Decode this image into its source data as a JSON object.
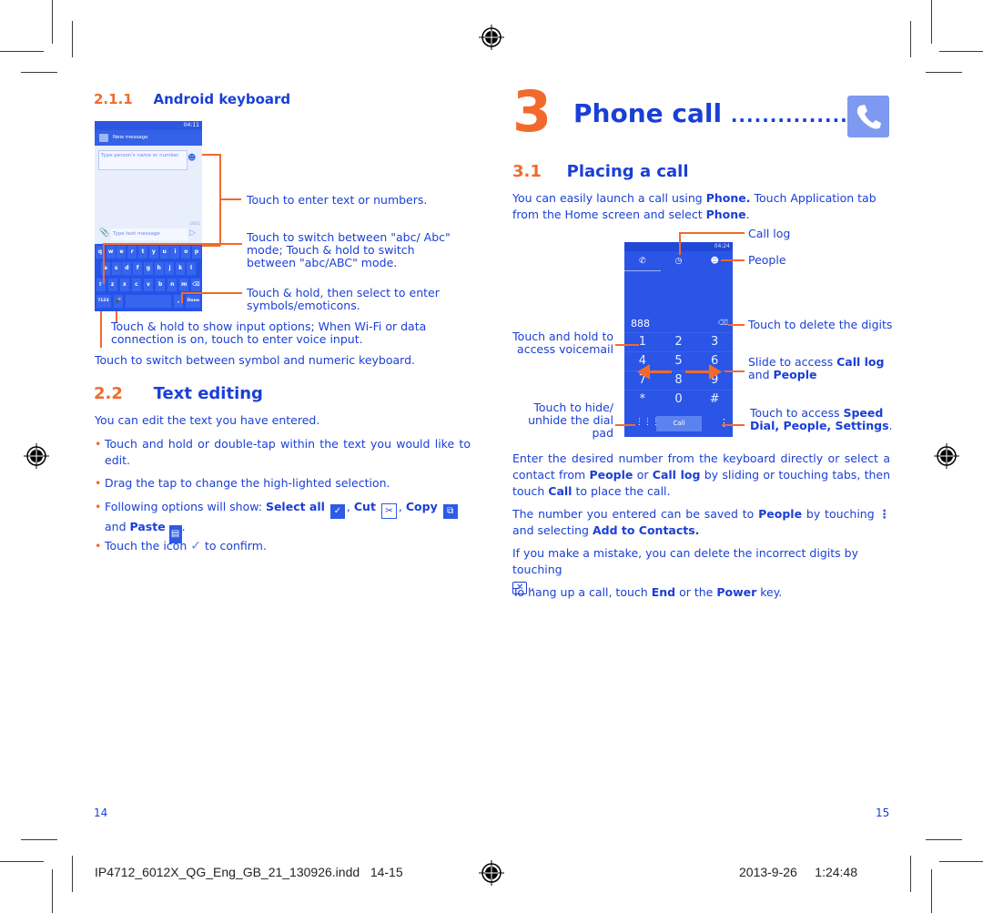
{
  "left_page": {
    "section_211": {
      "number": "2.1.1",
      "title": "Android keyboard"
    },
    "keyboard_phone": {
      "status_time": "04:11",
      "title": "New message",
      "recipient_placeholder": "Type person's name or number",
      "message_placeholder": "Type text message",
      "char_count": "160/1",
      "keys_row1": [
        "q",
        "w",
        "e",
        "r",
        "t",
        "y",
        "u",
        "i",
        "o",
        "p"
      ],
      "keys_row2": [
        "a",
        "s",
        "d",
        "f",
        "g",
        "h",
        "j",
        "k",
        "l"
      ],
      "keys_row3": [
        "z",
        "x",
        "c",
        "v",
        "b",
        "n",
        "m"
      ],
      "sym_key": "?123",
      "done_key": "Done"
    },
    "callouts": {
      "enter_text": "Touch to enter text or numbers.",
      "switch_case": "Touch to switch  between \"abc/ Abc\" mode; Touch & hold to switch between \"abc/ABC\" mode.",
      "symbols": "Touch & hold, then select to enter symbols/emoticons.",
      "voice": "Touch & hold to show input options; When Wi-Fi or data connection is on, touch to enter voice input.",
      "numeric": "Touch to switch between symbol and numeric keyboard."
    },
    "section_22": {
      "number": "2.2",
      "title": "Text editing"
    },
    "intro": "You can edit the text you have entered.",
    "bullets": {
      "b1": "Touch and hold or double-tap within the text you would like to edit.",
      "b2": "Drag the tap to change the high-lighted selection.",
      "b3_prefix": "Following options will show: ",
      "b3_select_all": "Select all",
      "b3_cut": "Cut",
      "b3_copy": "Copy",
      "b3_and": "and",
      "b3_paste": "Paste",
      "b4_prefix": "Touch the icon",
      "b4_suffix": "to confirm."
    },
    "page_number": "14"
  },
  "right_page": {
    "chapter": {
      "number": "3",
      "title": "Phone call",
      "leader": "..............."
    },
    "section_31": {
      "number": "3.1",
      "title": "Placing a call"
    },
    "intro_p1": "You can easily launch a call using",
    "intro_phone": "Phone.",
    "intro_p2": "Touch Application tab from the Home screen and select",
    "intro_phone2": "Phone",
    "dialer_phone": {
      "status_time": "04:24",
      "number": "888",
      "keys": [
        [
          "1",
          "2",
          "3"
        ],
        [
          "4",
          "5",
          "6"
        ],
        [
          "7",
          "8",
          "9"
        ],
        [
          "*",
          "0",
          "#"
        ]
      ],
      "call_button": "Call"
    },
    "callouts": {
      "call_log": "Call log",
      "people": "People",
      "delete": "Touch to delete the digits",
      "voicemail": "Touch and hold to access voicemail",
      "slide_pre": "Slide to access",
      "slide_call": "Call log",
      "slide_and": "and",
      "slide_people": "People",
      "hide_pad": "Touch to hide/ unhide the dial pad",
      "speed_pre": "Touch to access",
      "speed_bold": "Speed Dial, People, Settings"
    },
    "para1": {
      "a": "Enter the desired number from the keyboard directly or select a contact from",
      "b": "People",
      "c": "or",
      "d": "Call log",
      "e": "by sliding or touching tabs, then touch",
      "f": "Call",
      "g": "to place the call."
    },
    "para2": {
      "a": "The number you entered can be saved to",
      "b": "People",
      "c": "by touching",
      "d": "and selecting",
      "e": "Add to Contacts."
    },
    "para3": "If you make a mistake, you can delete the incorrect digits by touching",
    "para4": {
      "a": "To hang up a call, touch",
      "b": "End",
      "c": "or the",
      "d": "Power",
      "e": "key."
    },
    "page_number": "15"
  },
  "slug": {
    "filename": "IP4712_6012X_QG_Eng_GB_21_130926.indd",
    "pages": "14-15",
    "date": "2013-9-26",
    "time": "1:24:48"
  },
  "colors": {
    "text_blue": "#1a3fd6",
    "accent_orange": "#f26a2b",
    "phone_blue": "#2a55e6"
  }
}
